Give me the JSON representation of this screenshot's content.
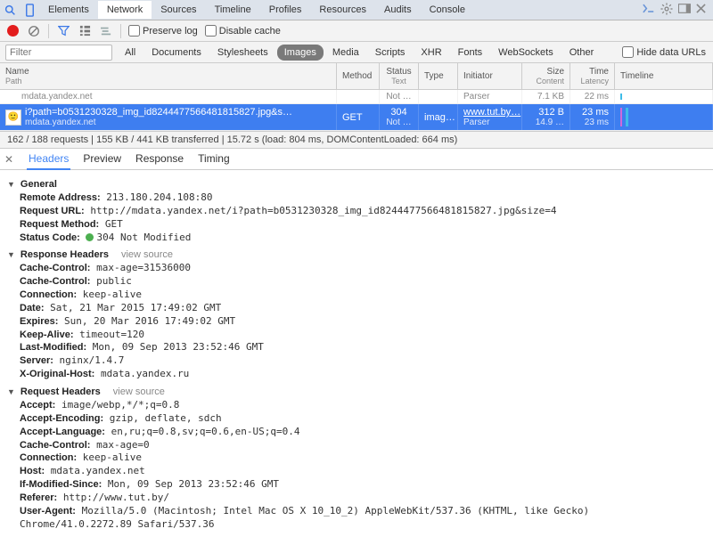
{
  "tabs": [
    "Elements",
    "Network",
    "Sources",
    "Timeline",
    "Profiles",
    "Resources",
    "Audits",
    "Console"
  ],
  "toolbar": {
    "preserve_log": "Preserve log",
    "disable_cache": "Disable cache"
  },
  "filter": {
    "placeholder": "Filter",
    "items": [
      "All",
      "Documents",
      "Stylesheets",
      "Images",
      "Media",
      "Scripts",
      "XHR",
      "Fonts",
      "WebSockets",
      "Other"
    ],
    "active": "Images",
    "hide_urls": "Hide data URLs"
  },
  "columns": {
    "name": "Name",
    "name_sub": "Path",
    "method": "Method",
    "status": "Status",
    "status_sub": "Text",
    "type": "Type",
    "initiator": "Initiator",
    "size": "Size",
    "size_sub": "Content",
    "time": "Time",
    "time_sub": "Latency",
    "timeline": "Timeline"
  },
  "rows": [
    {
      "name": "",
      "host": "mdata.yandex.net",
      "method": "",
      "status": "",
      "status_sub": "Not …",
      "type": "",
      "initiator": "",
      "initiator_sub": "Parser",
      "size": "",
      "size_sub": "7.1 KB",
      "time": "",
      "time_sub": "22 ms"
    },
    {
      "name": "i?path=b0531230328_img_id8244477566481815827.jpg&s…",
      "host": "mdata.yandex.net",
      "method": "GET",
      "status": "304",
      "status_sub": "Not …",
      "type": "imag…",
      "initiator": "www.tut.by…",
      "initiator_sub": "Parser",
      "size": "312 B",
      "size_sub": "14.9 …",
      "time": "23 ms",
      "time_sub": "23 ms"
    }
  ],
  "status": "162 / 188 requests | 155 KB / 441 KB transferred | 15.72 s (load: 804 ms, DOMContentLoaded: 664 ms)",
  "detail_tabs": [
    "Headers",
    "Preview",
    "Response",
    "Timing"
  ],
  "general": {
    "title": "General",
    "remote": "213.180.204.108:80",
    "url": "http://mdata.yandex.net/i?path=b0531230328_img_id8244477566481815827.jpg&size=4",
    "method": "GET",
    "status": "304 Not Modified"
  },
  "response_headers": {
    "title": "Response Headers",
    "view_source": "view source",
    "items": [
      [
        "Cache-Control:",
        "max-age=31536000"
      ],
      [
        "Cache-Control:",
        "public"
      ],
      [
        "Connection:",
        "keep-alive"
      ],
      [
        "Date:",
        "Sat, 21 Mar 2015 17:49:02 GMT"
      ],
      [
        "Expires:",
        "Sun, 20 Mar 2016 17:49:02 GMT"
      ],
      [
        "Keep-Alive:",
        "timeout=120"
      ],
      [
        "Last-Modified:",
        "Mon, 09 Sep 2013 23:52:46 GMT"
      ],
      [
        "Server:",
        "nginx/1.4.7"
      ],
      [
        "X-Original-Host:",
        "mdata.yandex.ru"
      ]
    ]
  },
  "request_headers": {
    "title": "Request Headers",
    "view_source": "view source",
    "items": [
      [
        "Accept:",
        "image/webp,*/*;q=0.8"
      ],
      [
        "Accept-Encoding:",
        "gzip, deflate, sdch"
      ],
      [
        "Accept-Language:",
        "en,ru;q=0.8,sv;q=0.6,en-US;q=0.4"
      ],
      [
        "Cache-Control:",
        "max-age=0"
      ],
      [
        "Connection:",
        "keep-alive"
      ],
      [
        "Host:",
        "mdata.yandex.net"
      ],
      [
        "If-Modified-Since:",
        "Mon, 09 Sep 2013 23:52:46 GMT"
      ],
      [
        "Referer:",
        "http://www.tut.by/"
      ],
      [
        "User-Agent:",
        "Mozilla/5.0 (Macintosh; Intel Mac OS X 10_10_2) AppleWebKit/537.36 (KHTML, like Gecko) Chrome/41.0.2272.89 Safari/537.36"
      ]
    ]
  },
  "labels": {
    "remote": "Remote Address:",
    "url": "Request URL:",
    "method": "Request Method:",
    "status": "Status Code:"
  }
}
